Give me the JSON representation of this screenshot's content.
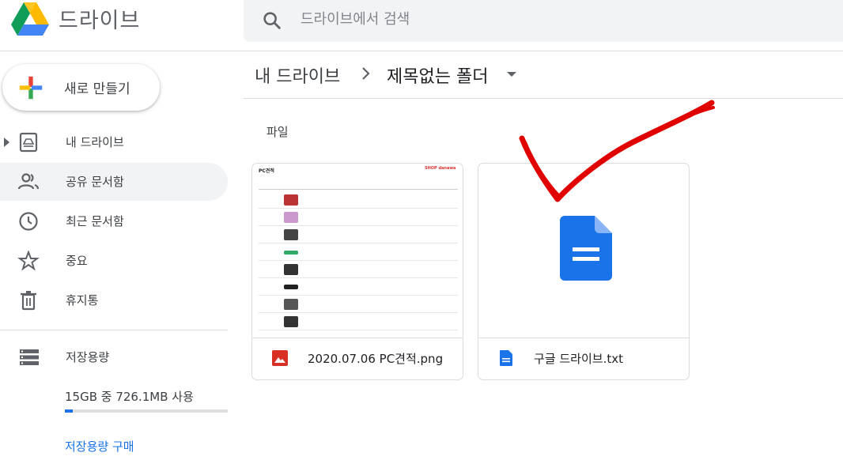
{
  "app": {
    "title": "드라이브"
  },
  "search": {
    "placeholder": "드라이브에서 검색"
  },
  "new_button": {
    "label": "새로 만들기"
  },
  "sidebar": {
    "items": [
      {
        "label": "내 드라이브",
        "icon": "my-drive-icon"
      },
      {
        "label": "공유 문서함",
        "icon": "people-icon"
      },
      {
        "label": "최근 문서함",
        "icon": "clock-icon"
      },
      {
        "label": "중요",
        "icon": "star-icon"
      },
      {
        "label": "휴지통",
        "icon": "trash-icon"
      }
    ]
  },
  "storage": {
    "label": "저장용량",
    "usage_text": "15GB 중 726.1MB 사용",
    "used_fraction": 0.047,
    "buy_label": "저장용량 구매"
  },
  "breadcrumb": {
    "root": "내 드라이브",
    "current": "제목없는 폴더"
  },
  "files_section": {
    "label": "파일"
  },
  "files": [
    {
      "name": "2020.07.06 PC견적.png",
      "type": "image",
      "icon": "image-file-icon"
    },
    {
      "name": "구글 드라이브.txt",
      "type": "document",
      "icon": "docs-file-icon"
    }
  ],
  "thumbnail_sheet": {
    "title": "PC견적",
    "brand": "SHOP danawa"
  },
  "colors": {
    "accent": "#1a73e8",
    "image_icon": "#d93025",
    "annotation": "#e00000"
  }
}
